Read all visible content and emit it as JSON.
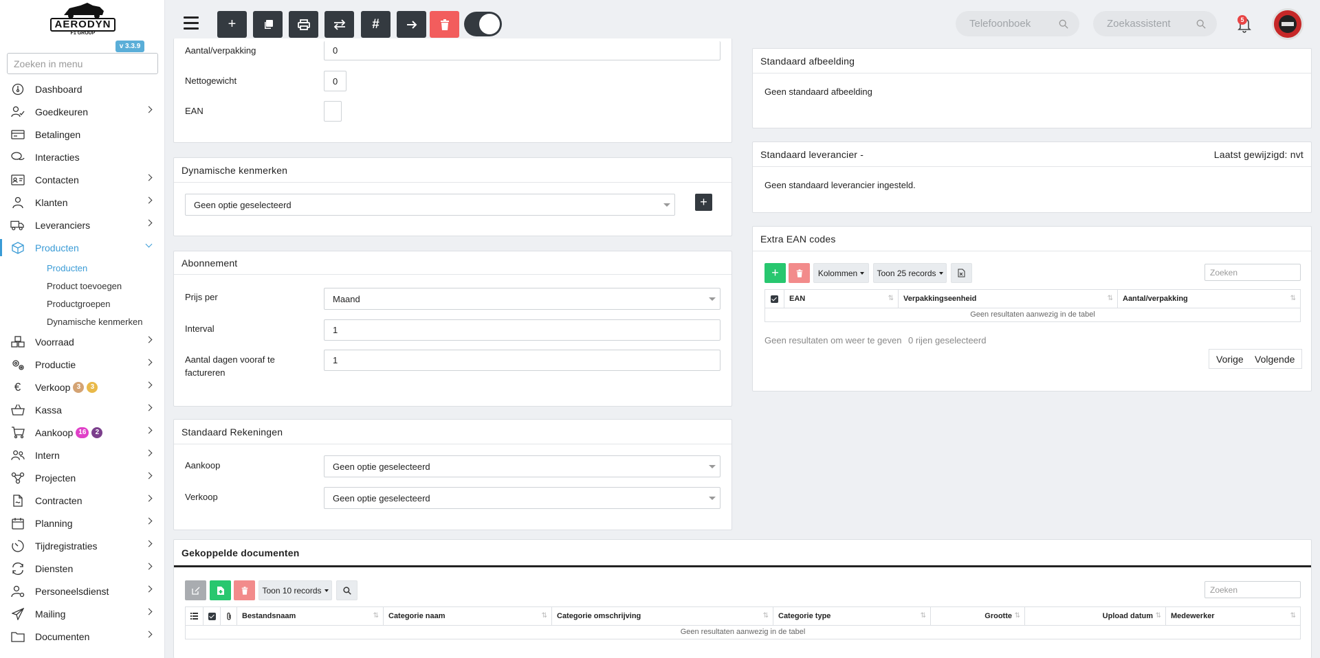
{
  "app": {
    "logo_text": "AERODYN",
    "logo_sub": "F1 GROUP",
    "version": "v 3.3.9"
  },
  "sidebar": {
    "search_placeholder": "Zoeken in menu",
    "items": [
      {
        "label": "Dashboard",
        "icon": "dashboard-icon"
      },
      {
        "label": "Goedkeuren",
        "icon": "user-check-icon"
      },
      {
        "label": "Betalingen",
        "icon": "credit-card-icon"
      },
      {
        "label": "Interacties",
        "icon": "chat-icon"
      },
      {
        "label": "Contacten",
        "icon": "contact-card-icon"
      },
      {
        "label": "Klanten",
        "icon": "user-icon"
      },
      {
        "label": "Leveranciers",
        "icon": "truck-icon"
      },
      {
        "label": "Producten",
        "icon": "box-icon"
      },
      {
        "label": "Voorraad",
        "icon": "boxes-icon"
      },
      {
        "label": "Productie",
        "icon": "gears-icon"
      },
      {
        "label": "Verkoop",
        "icon": "euro-icon",
        "badges": [
          "3",
          "3"
        ]
      },
      {
        "label": "Kassa",
        "icon": "basket-icon"
      },
      {
        "label": "Aankoop",
        "icon": "cart-icon",
        "badges": [
          "16",
          "2"
        ]
      },
      {
        "label": "Intern",
        "icon": "users-icon"
      },
      {
        "label": "Projecten",
        "icon": "project-icon"
      },
      {
        "label": "Contracten",
        "icon": "contract-icon"
      },
      {
        "label": "Planning",
        "icon": "calendar-icon"
      },
      {
        "label": "Tijdregistraties",
        "icon": "timer-icon"
      },
      {
        "label": "Diensten",
        "icon": "exchange-icon"
      },
      {
        "label": "Personeelsdienst",
        "icon": "person-gear-icon"
      },
      {
        "label": "Mailing",
        "icon": "send-icon"
      },
      {
        "label": "Documenten",
        "icon": "folder-icon"
      }
    ],
    "sub_items": [
      "Producten",
      "Product toevoegen",
      "Productgroepen",
      "Dynamische kenmerken"
    ],
    "badge_colors": {
      "verkoop_1": "#d4a373",
      "verkoop_2": "#e9b949",
      "aankoop_1": "#e040c8",
      "aankoop_2": "#7b3f8c"
    }
  },
  "topbar": {
    "phonebook_placeholder": "Telefoonboek",
    "assistant_placeholder": "Zoekassistent",
    "notification_count": "5"
  },
  "product_form": {
    "aantal_label": "Aantal/verpakking",
    "aantal_value": "0",
    "netto_label": "Nettogewicht",
    "netto_value": "0",
    "ean_label": "EAN",
    "ean_value": ""
  },
  "dynamic": {
    "title": "Dynamische kenmerken",
    "select_value": "Geen optie geselecteerd"
  },
  "abonnement": {
    "title": "Abonnement",
    "prijs_label": "Prijs per",
    "prijs_value": "Maand",
    "interval_label": "Interval",
    "interval_value": "1",
    "dagen_label": "Aantal dagen vooraf te factureren",
    "dagen_value": "1"
  },
  "rekeningen": {
    "title": "Standaard Rekeningen",
    "aankoop_label": "Aankoop",
    "aankoop_value": "Geen optie geselecteerd",
    "verkoop_label": "Verkoop",
    "verkoop_value": "Geen optie geselecteerd"
  },
  "afbeelding": {
    "title": "Standaard afbeelding",
    "text": "Geen standaard afbeelding"
  },
  "leverancier": {
    "title": "Standaard leverancier -",
    "modified": "Laatst gewijzigd: nvt",
    "text": "Geen standaard leverancier ingesteld."
  },
  "ean_codes": {
    "title": "Extra EAN codes",
    "kolommen": "Kolommen",
    "toon": "Toon 25 records",
    "search_placeholder": "Zoeken",
    "columns": [
      "EAN",
      "Verpakkingseenheid",
      "Aantal/verpakking"
    ],
    "empty": "Geen resultaten aanwezig in de tabel",
    "info": "Geen resultaten om weer te geven",
    "selected": "0 rijen geselecteerd",
    "prev": "Vorige",
    "next": "Volgende"
  },
  "documents": {
    "title": "Gekoppelde documenten",
    "toon": "Toon 10 records",
    "search_placeholder": "Zoeken",
    "columns": [
      "Bestandsnaam",
      "Categorie naam",
      "Categorie omschrijving",
      "Categorie type",
      "Grootte",
      "Upload datum",
      "Medewerker"
    ],
    "empty": "Geen resultaten aanwezig in de tabel"
  },
  "colors": {
    "accent": "#3a9bd6",
    "dark": "#343a40",
    "danger": "#f25d5d",
    "success": "#28c76f"
  }
}
